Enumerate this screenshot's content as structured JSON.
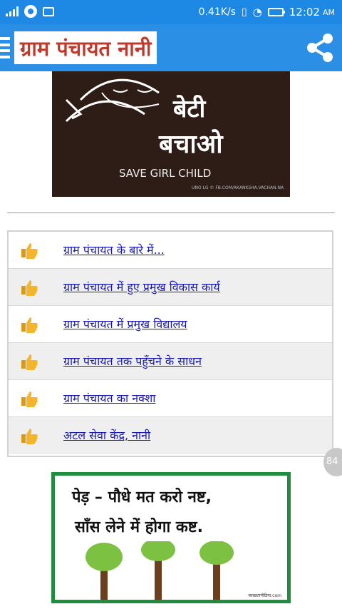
{
  "status_bar": {
    "speed": "0.41K/s",
    "time": "12:02",
    "ampm": "AM"
  },
  "app_bar": {
    "title": "ग्राम पंचायत नानी",
    "menu_icon": "hamburger-icon",
    "share_icon": "share-icon"
  },
  "banner": {
    "line1": "बेटी",
    "line2": "बचाओ",
    "subtitle": "SAVE GIRL CHILD",
    "credit": "UNO LG © FB.COM/AKANKSHA.VACHAN.NA"
  },
  "list": {
    "icon": "thumbs-up-icon",
    "items": [
      {
        "label": "ग्राम पंचायत के बारे में..."
      },
      {
        "label": "ग्राम पंचायत  में हुए प्रमुख विकास कार्य"
      },
      {
        "label": "ग्राम पंचायत में प्रमुख विद्यालय"
      },
      {
        "label": "ग्राम पंचायत तक पहुँचने के साधन"
      },
      {
        "label": "ग्राम पंचायत का नक्शा"
      },
      {
        "label": "अटल सेवा केंद्र, नानी"
      }
    ]
  },
  "floating_badge": "84",
  "poster": {
    "line1": "पेड़ – पौधे मत करो नष्ट,",
    "line2": "साँस लेने में होगा कष्ट.",
    "site": "स्वच्छतापीडिया.com"
  },
  "colors": {
    "status_bar": "#1e88e5",
    "app_bar": "#2b8fe6",
    "title_text": "#c0392b",
    "link": "#1a1ab0",
    "poster_border": "#1e8d3e"
  }
}
